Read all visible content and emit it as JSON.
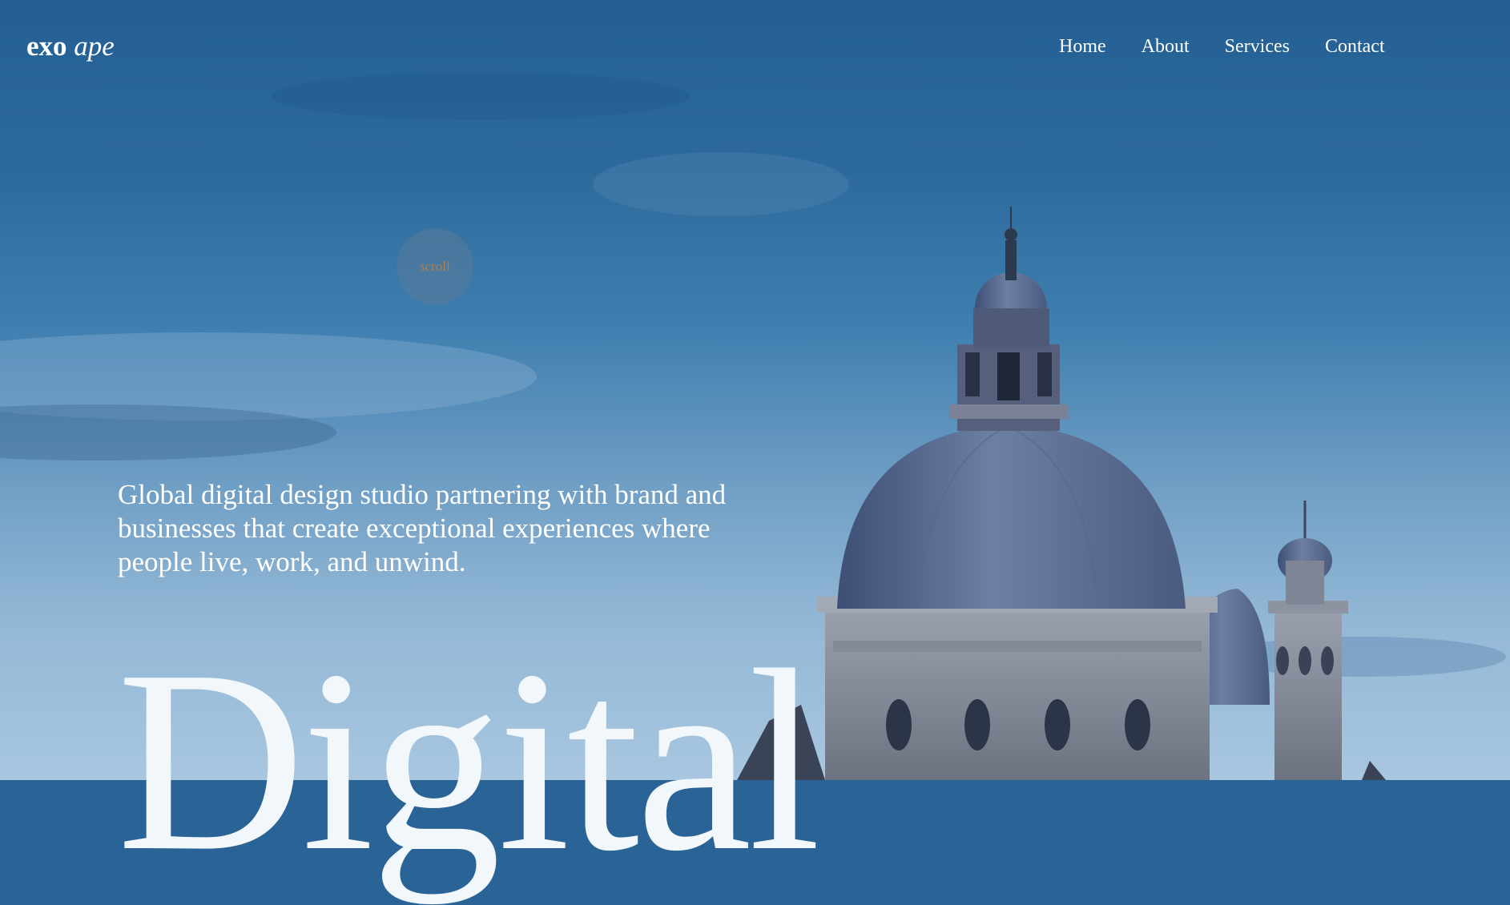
{
  "brand": {
    "logo_bold": "exo",
    "logo_italic": "ape"
  },
  "nav": {
    "items": [
      "Home",
      "About",
      "Services",
      "Contact"
    ]
  },
  "hero": {
    "scroll_label": "scroll",
    "tagline": "Global digital design studio partnering with brand and businesses that create exceptional experiences where people live, work, and unwind.",
    "big_word": "Digital",
    "background": "domed-church-at-dusk-photo"
  },
  "colors": {
    "sky_top": "#235f93",
    "sky_bottom": "#a8c6df",
    "text": "#ffffff",
    "scroll_text": "#b07f4f"
  }
}
